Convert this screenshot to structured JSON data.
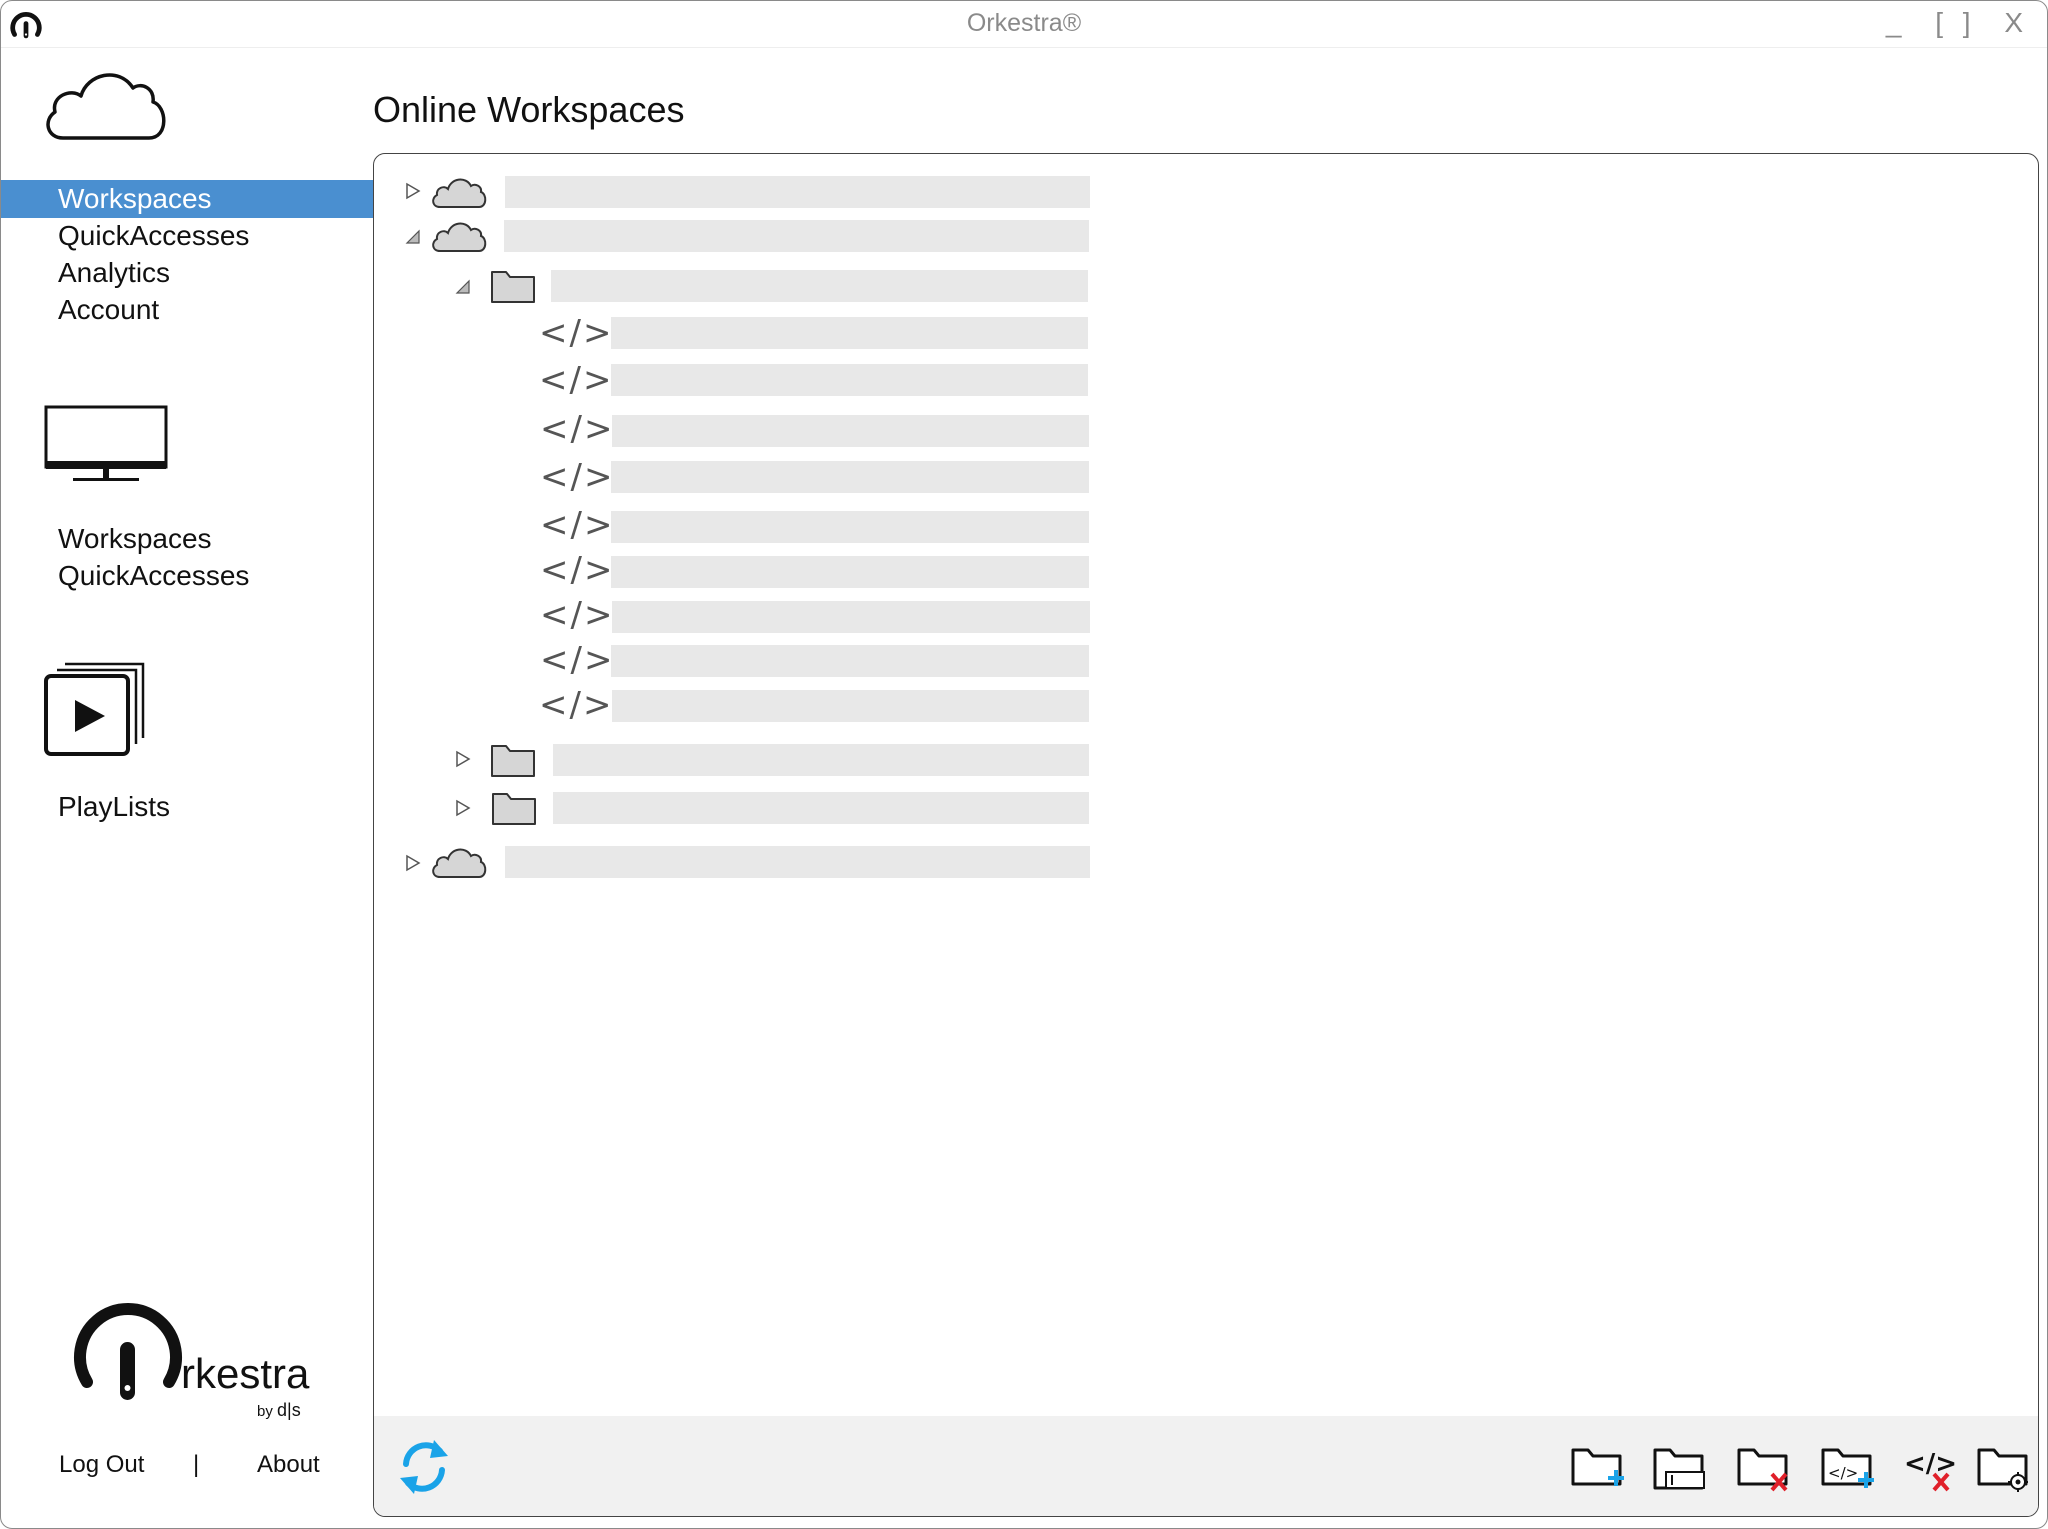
{
  "window": {
    "title": "Orkestra®",
    "controls": [
      "_",
      "[ ]",
      "X"
    ]
  },
  "sidebar": {
    "nav": [
      {
        "label": "Workspaces",
        "active": true
      },
      {
        "label": "QuickAccesses",
        "active": false
      },
      {
        "label": "Analytics",
        "active": false
      },
      {
        "label": "Account",
        "active": false
      }
    ],
    "local_section": [
      "Workspaces",
      "QuickAccesses"
    ],
    "playlists_label": "PlayLists",
    "brand": {
      "name": "rkestra",
      "by": "by",
      "ds": "d|s"
    },
    "log_out": "Log Out",
    "separator": "|",
    "about": "About"
  },
  "main": {
    "title": "Online Workspaces",
    "code_glyph": "</>",
    "tree": [
      {
        "type": "cloud",
        "expanded": false
      },
      {
        "type": "cloud",
        "expanded": true
      },
      {
        "type": "folder",
        "expanded": true
      },
      {
        "type": "script"
      },
      {
        "type": "script"
      },
      {
        "type": "script"
      },
      {
        "type": "script"
      },
      {
        "type": "script"
      },
      {
        "type": "script"
      },
      {
        "type": "script"
      },
      {
        "type": "script"
      },
      {
        "type": "script"
      },
      {
        "type": "folder",
        "expanded": false
      },
      {
        "type": "folder",
        "expanded": false
      },
      {
        "type": "cloud",
        "expanded": false
      }
    ]
  },
  "toolbar": {
    "icons": [
      "refresh-icon",
      "add-folder-icon",
      "rename-folder-icon",
      "delete-folder-icon",
      "add-script-icon",
      "delete-script-icon",
      "folder-settings-icon"
    ],
    "accent": "#1aa3e8",
    "danger": "#e0202a",
    "selection": "#4a8fd0"
  }
}
